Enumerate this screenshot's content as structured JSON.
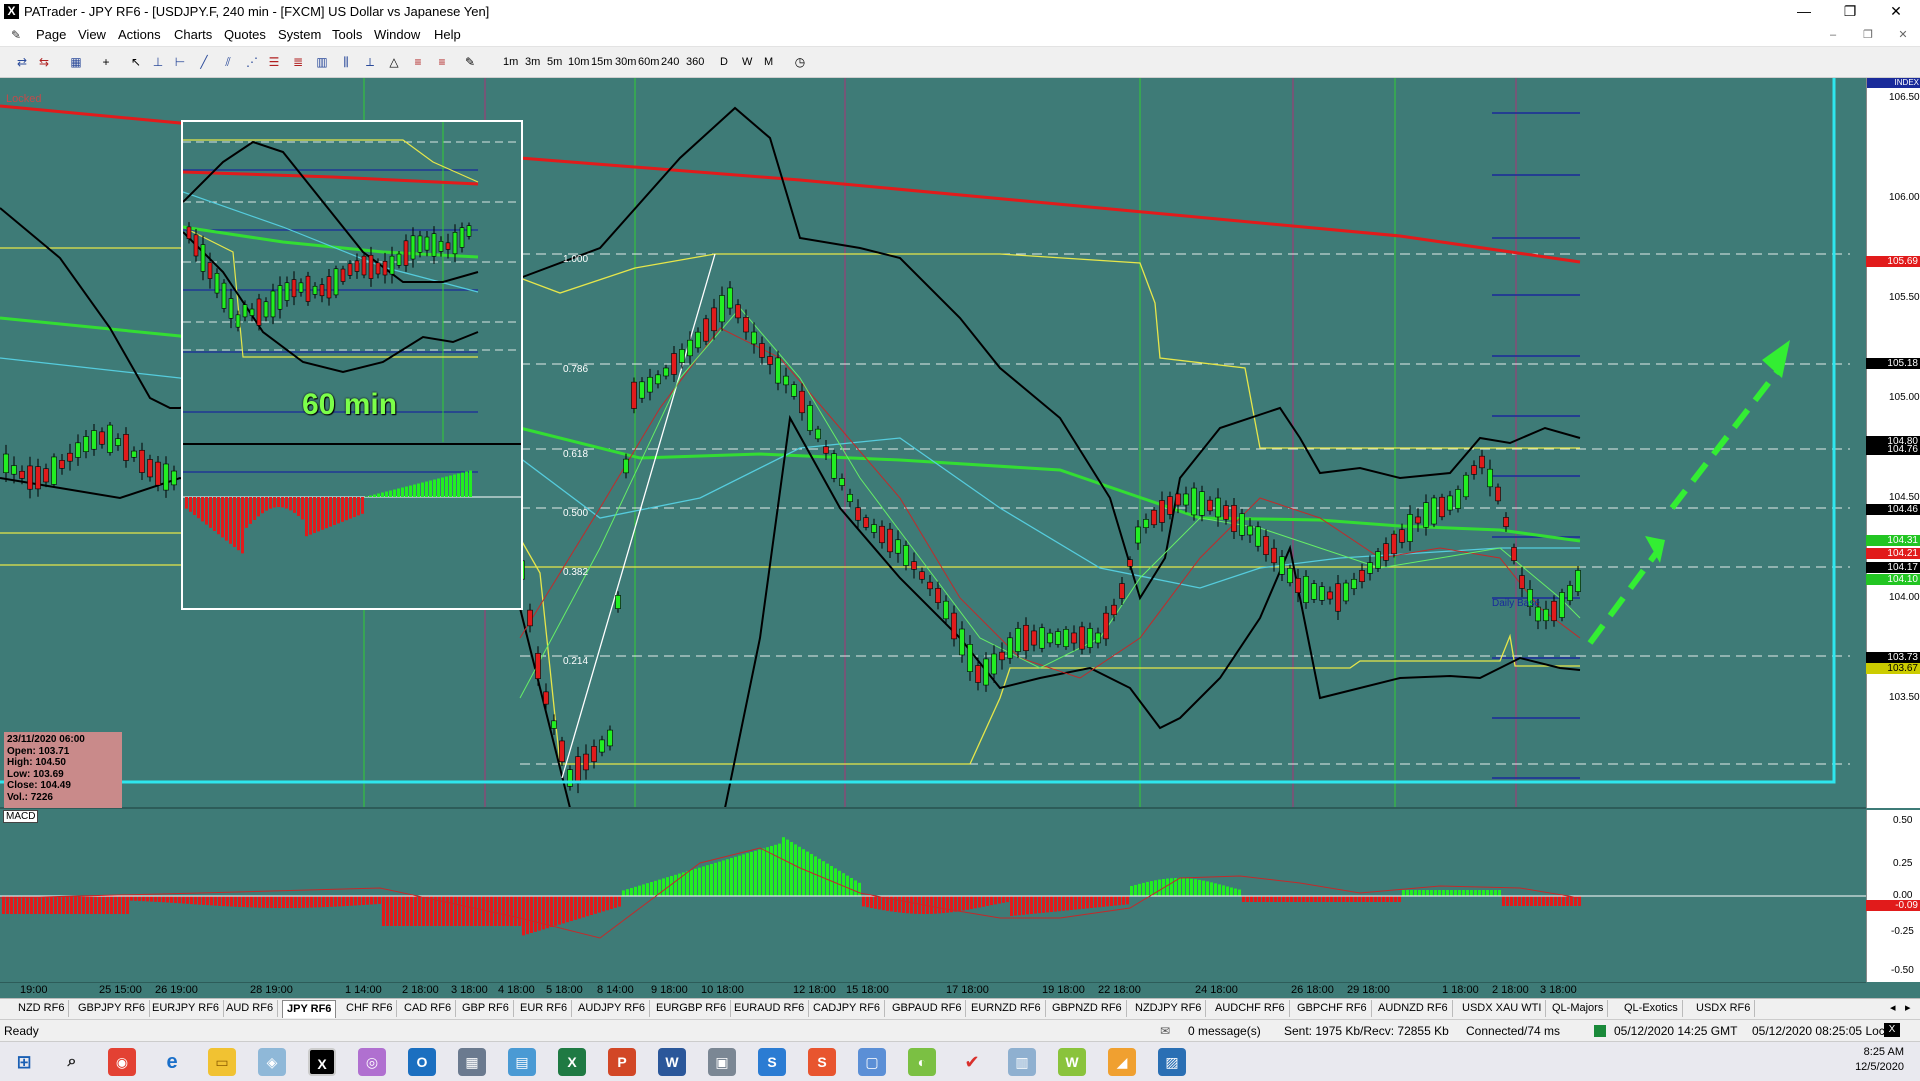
{
  "window": {
    "title": "PATrader - JPY RF6 - [USDJPY.F, 240 min - [FXCM] US Dollar vs Japanese Yen]",
    "app_icon": "X",
    "minimize": "—",
    "restore": "❐",
    "close": "✕"
  },
  "menu": {
    "items": [
      "Page",
      "View",
      "Actions",
      "Charts",
      "Quotes",
      "System",
      "Tools",
      "Window",
      "Help"
    ]
  },
  "toolbar": {
    "timeframes": [
      "1m",
      "3m",
      "5m",
      "10m",
      "15m",
      "30m",
      "60m",
      "240",
      "360",
      "D",
      "W",
      "M"
    ]
  },
  "chart": {
    "locked_label": "Locked",
    "index_label": "INDEX",
    "macd_label": "MACD",
    "inset_label": "60 min",
    "fib_labels": [
      "1.000",
      "0.786",
      "0.618",
      "0.500",
      "0.382",
      "0.214"
    ],
    "chart_label": "Daily Base",
    "price_ticks": [
      "106.50",
      "106.00",
      "105.50",
      "105.00",
      "104.50",
      "104.00",
      "103.50"
    ],
    "price_tags": [
      {
        "text": "105.69",
        "color": "#e11b1b"
      },
      {
        "text": "105.18",
        "color": "#000000"
      },
      {
        "text": "104.80",
        "color": "#000000"
      },
      {
        "text": "104.76",
        "color": "#000000"
      },
      {
        "text": "104.46",
        "color": "#000000"
      },
      {
        "text": "104.31",
        "color": "#22c522"
      },
      {
        "text": "104.21",
        "color": "#e11b1b"
      },
      {
        "text": "104.17",
        "color": "#000000"
      },
      {
        "text": "104.10",
        "color": "#22c522"
      },
      {
        "text": "103.73",
        "color": "#000000"
      },
      {
        "text": "103.67",
        "color": "#cccc00"
      }
    ],
    "macd_ticks": [
      "0.50",
      "0.25",
      "0.00",
      "-0.25",
      "-0.50"
    ],
    "macd_tag": "-0.09",
    "time_labels": [
      "19:00",
      "25 15:00",
      "26 19:00",
      "28 19:00",
      "1 14:00",
      "2 18:00",
      "3 18:00",
      "4 18:00",
      "5 18:00",
      "8 14:00",
      "9 18:00",
      "10 18:00",
      "12 18:00",
      "15 18:00",
      "17 18:00",
      "19 18:00",
      "22 18:00",
      "24 18:00",
      "26 18:00",
      "29 18:00",
      "1 18:00",
      "2 18:00",
      "3 18:00"
    ],
    "ohlc": {
      "date": "23/11/2020 06:00",
      "open": "Open: 103.71",
      "high": "High: 104.50",
      "low": "Low: 103.69",
      "close": "Close: 104.49",
      "vol": "Vol.: 7226"
    },
    "colors": {
      "background": "#3e7b77",
      "bull": "#22ee22",
      "bear": "#e11b1b",
      "ma_long": "#e11b1b",
      "ma_mid": "#33dd33",
      "band": "#000000",
      "channel": "#e6e64a",
      "border": "#2ee6ee"
    }
  },
  "tabs": {
    "items": [
      "NZD RF6",
      "GBPJPY RF6",
      "EURJPY RF6",
      "AUD RF6",
      "JPY RF6",
      "CHF RF6",
      "CAD RF6",
      "GBP RF6",
      "EUR RF6",
      "AUDJPY RF6",
      "EURGBP RF6",
      "EURAUD RF6",
      "CADJPY RF6",
      "GBPAUD RF6",
      "EURNZD RF6",
      "GBPNZD RF6",
      "NZDJPY RF6",
      "AUDCHF RF6",
      "GBPCHF RF6",
      "AUDNZD RF6",
      "USDX XAU WTI",
      "QL-Majors",
      "QL-Exotics",
      "USDX RF6"
    ],
    "active": "JPY RF6"
  },
  "status": {
    "ready": "Ready",
    "messages": "0 message(s)",
    "sent": "Sent: 1975 Kb/Recv: 72855 Kb",
    "connected": "Connected/74 ms",
    "time": "05/12/2020 14:25 GMT",
    "local": "05/12/2020 08:25:05 Local"
  },
  "taskbar": {
    "time": "8:25 AM",
    "date": "12/5/2020"
  }
}
